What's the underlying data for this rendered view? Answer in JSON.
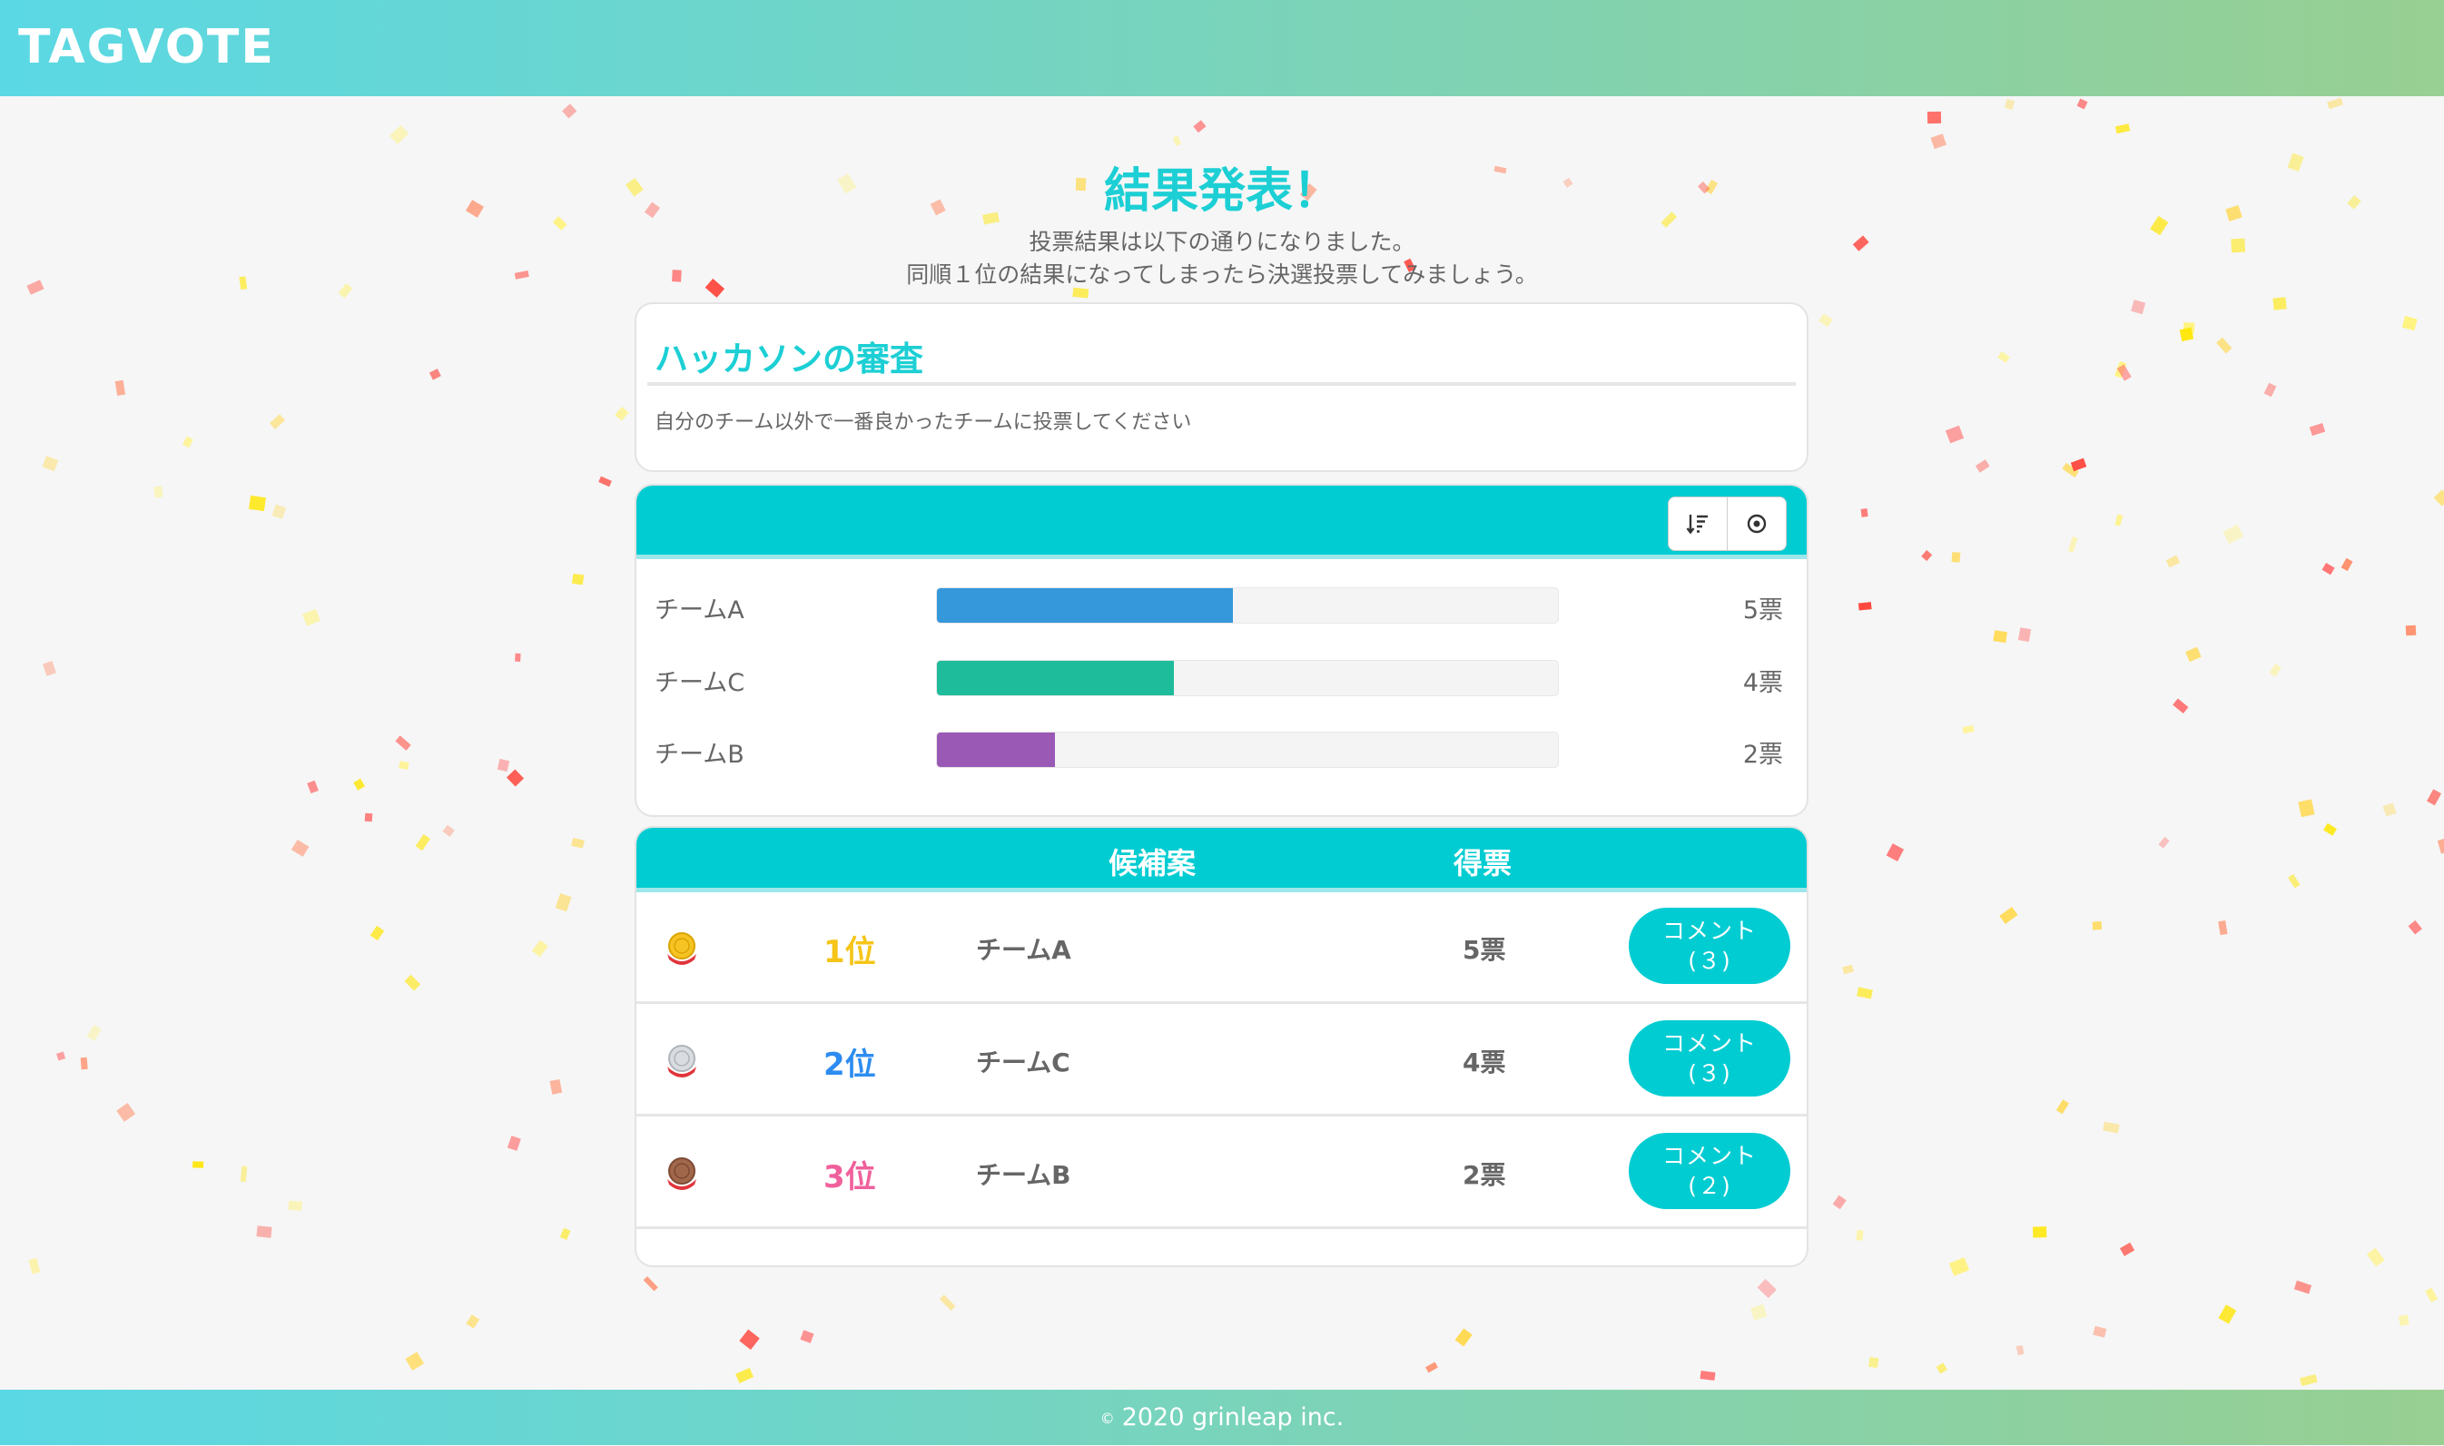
{
  "header": {
    "logo": "TAGVOTE"
  },
  "result": {
    "title": "結果発表！",
    "line1": "投票結果は以下の通りになりました。",
    "line2": "同順１位の結果になってしまったら決選投票してみましょう。"
  },
  "question": {
    "title": "ハッカソンの審査",
    "description": "自分のチーム以外で一番良かったチームに投票してください"
  },
  "chart_toolbar": {
    "sort_icon": "sort-descending-icon",
    "target_icon": "target-icon"
  },
  "chart_data": {
    "type": "bar",
    "orientation": "horizontal",
    "categories": [
      "チームA",
      "チームC",
      "チームB"
    ],
    "values": [
      5,
      4,
      2
    ],
    "value_labels": [
      "5票",
      "4票",
      "2票"
    ],
    "colors": [
      "#3498db",
      "#1fbc9c",
      "#9b59b6"
    ],
    "xlim": [
      0,
      10.5
    ]
  },
  "table": {
    "headers": {
      "candidate": "候補案",
      "votes": "得票"
    },
    "rows": [
      {
        "medal": "gold-medal-icon",
        "rank": "1位",
        "rank_color": "#f5c518",
        "team": "チームA",
        "votes": "5票",
        "comment": "コメント(３)"
      },
      {
        "medal": "silver-medal-icon",
        "rank": "2位",
        "rank_color": "#2d8cf0",
        "team": "チームC",
        "votes": "4票",
        "comment": "コメント(３)"
      },
      {
        "medal": "bronze-medal-icon",
        "rank": "3位",
        "rank_color": "#f0609c",
        "team": "チームB",
        "votes": "2票",
        "comment": "コメント(２)"
      }
    ]
  },
  "footer": {
    "copyright": "2020 grinleap inc."
  },
  "colors": {
    "accent": "#00ccd2",
    "header_start": "#5ad8e4",
    "header_end": "#98cf92"
  }
}
